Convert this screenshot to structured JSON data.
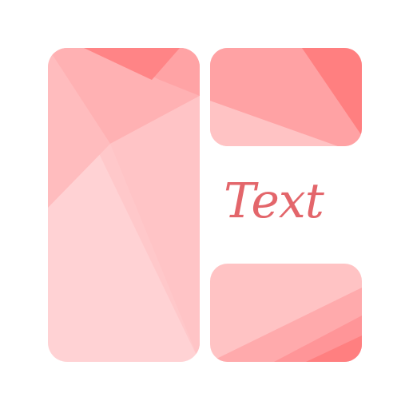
{
  "app_icon": {
    "label": "Text",
    "colors": {
      "text": "#e3666b",
      "light": "#ffd2d4",
      "mid_light": "#ffc0c1",
      "mid": "#ffa9aa",
      "mid_dark": "#ff9597",
      "dark": "#ff7a7b",
      "background": "#ffffff"
    }
  }
}
